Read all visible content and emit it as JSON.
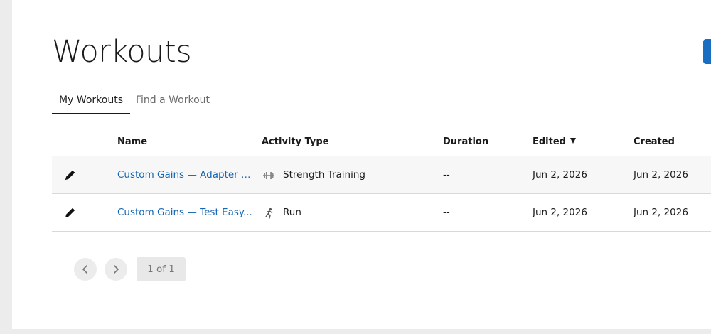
{
  "page": {
    "title": "Workouts"
  },
  "tabs": [
    {
      "label": "My Workouts",
      "active": true
    },
    {
      "label": "Find a Workout",
      "active": false
    }
  ],
  "table": {
    "columns": {
      "name": "Name",
      "activity_type": "Activity Type",
      "duration": "Duration",
      "edited": "Edited",
      "created": "Created"
    },
    "sorted_by": "Edited",
    "sort_direction": "descending",
    "rows": [
      {
        "name": "Custom Gains — Adapter T...",
        "activity_icon": "dumbbell-icon",
        "activity": "Strength Training",
        "duration": "--",
        "edited": "Jun 2, 2026",
        "created": "Jun 2, 2026"
      },
      {
        "name": "Custom Gains — Test Easy...",
        "activity_icon": "runner-icon",
        "activity": "Run",
        "duration": "--",
        "edited": "Jun 2, 2026",
        "created": "Jun 2, 2026"
      }
    ]
  },
  "pagination": {
    "status": "1 of 1"
  },
  "colors": {
    "accent": "#1a6ec2",
    "link": "#1566b3",
    "text": "#1a1a1a",
    "muted": "#6a6a6a",
    "background": "#ececec"
  }
}
